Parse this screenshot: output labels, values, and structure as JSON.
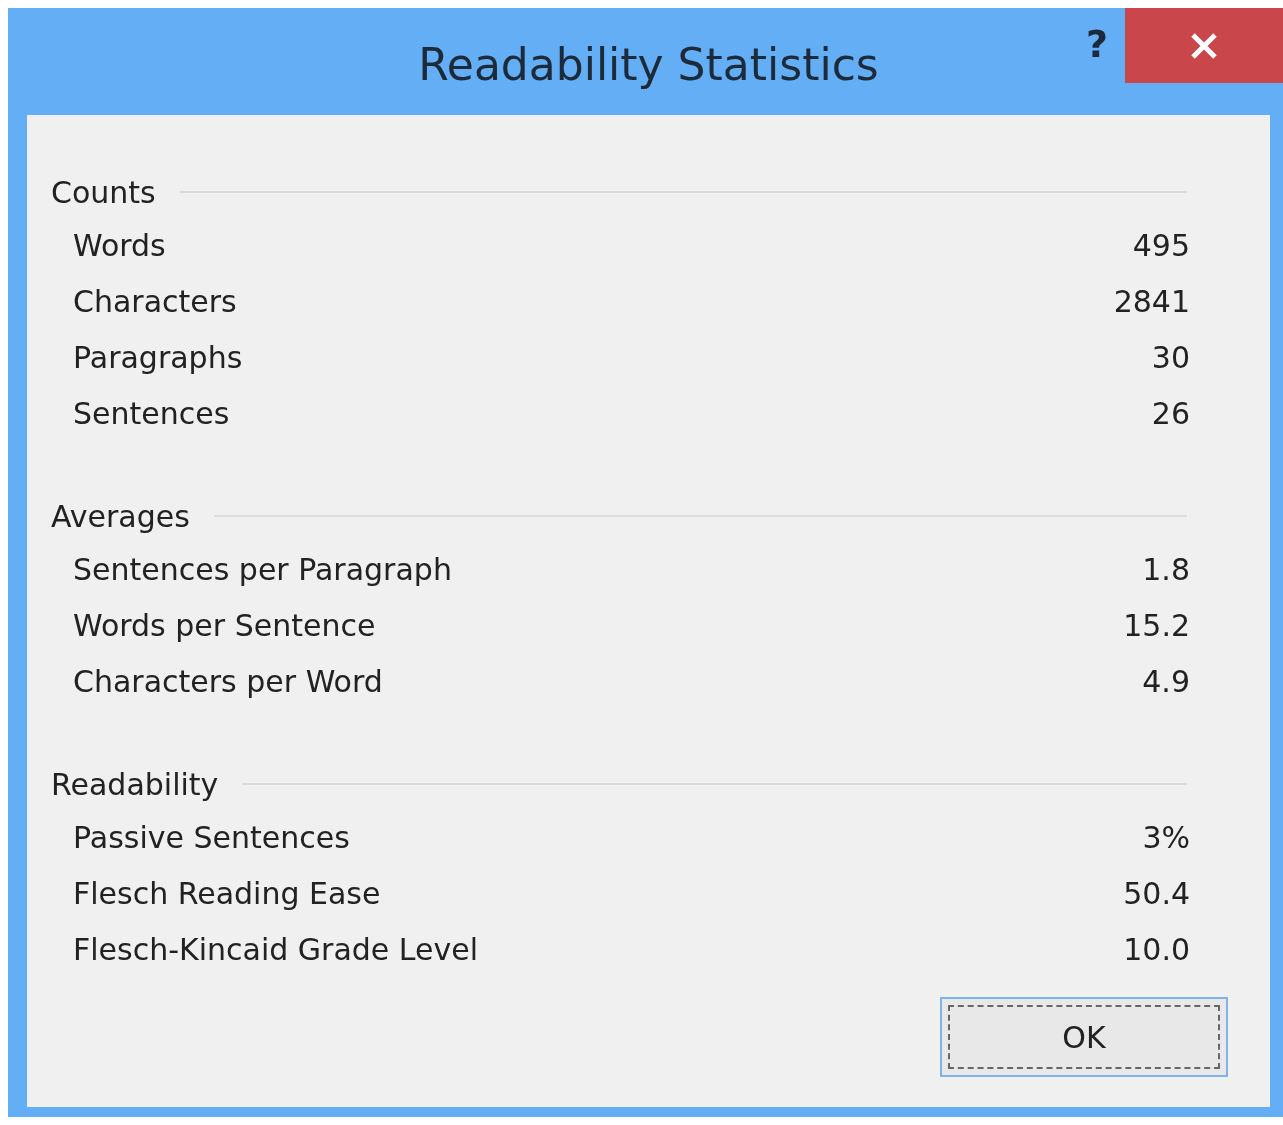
{
  "window": {
    "title": "Readability Statistics",
    "help_button": "?"
  },
  "sections": [
    {
      "heading": "Counts",
      "rows": [
        {
          "label": "Words",
          "value": "495"
        },
        {
          "label": "Characters",
          "value": "2841"
        },
        {
          "label": "Paragraphs",
          "value": "30"
        },
        {
          "label": "Sentences",
          "value": "26"
        }
      ]
    },
    {
      "heading": "Averages",
      "rows": [
        {
          "label": "Sentences per Paragraph",
          "value": "1.8"
        },
        {
          "label": "Words per Sentence",
          "value": "15.2"
        },
        {
          "label": "Characters per Word",
          "value": "4.9"
        }
      ]
    },
    {
      "heading": "Readability",
      "rows": [
        {
          "label": "Passive Sentences",
          "value": "3%"
        },
        {
          "label": "Flesch Reading Ease",
          "value": "50.4"
        },
        {
          "label": "Flesch-Kincaid Grade Level",
          "value": "10.0"
        }
      ]
    }
  ],
  "buttons": [
    "OK"
  ]
}
